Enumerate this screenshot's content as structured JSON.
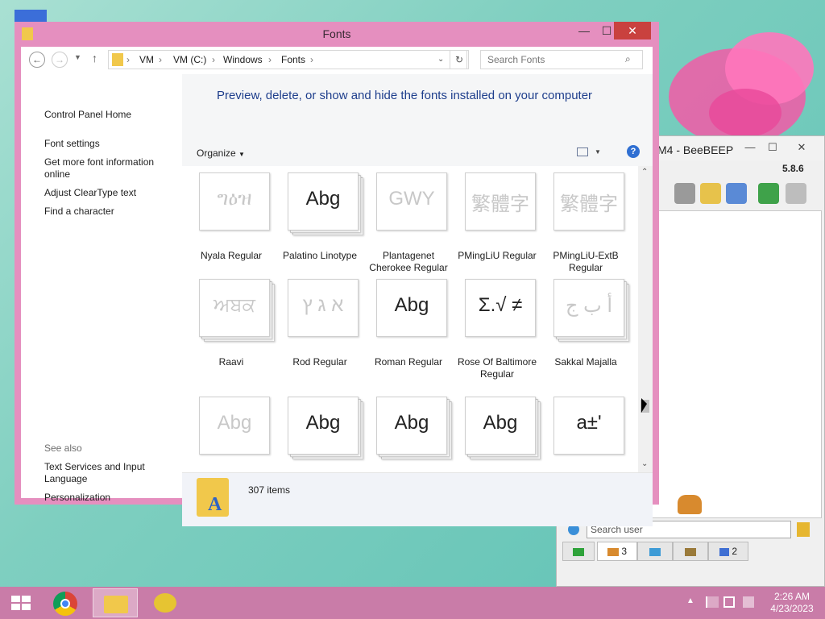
{
  "fonts_window": {
    "title": "Fonts",
    "close_glyph": "✕",
    "minimize_glyph": "—",
    "maximize_glyph": "☐",
    "breadcrumbs": [
      "VM",
      "VM (C:)",
      "Windows",
      "Fonts"
    ],
    "search_placeholder": "Search Fonts",
    "left_links": [
      "Control Panel Home",
      "Font settings",
      "Get more font information online",
      "Adjust ClearType text",
      "Find a character"
    ],
    "see_also_label": "See also",
    "see_also_links": [
      "Text Services and Input Language",
      "Personalization"
    ],
    "heading": "Preview, delete, or show and hide the fonts installed on your computer",
    "organize_label": "Organize",
    "help_glyph": "?",
    "status_count": "307 items",
    "fonts": [
      {
        "name": "Nyala Regular",
        "sample": "ግዕዝ",
        "stack": false,
        "dim": true
      },
      {
        "name": "Palatino Linotype",
        "sample": "Abg",
        "stack": true,
        "dim": false
      },
      {
        "name": "Plantagenet Cherokee Regular",
        "sample": "GWY",
        "stack": false,
        "dim": true
      },
      {
        "name": "PMingLiU Regular",
        "sample": "繁體字",
        "stack": false,
        "dim": true
      },
      {
        "name": "PMingLiU-ExtB Regular",
        "sample": "繁體字",
        "stack": false,
        "dim": true
      },
      {
        "name": "Raavi",
        "sample": "ਅਬਕ",
        "stack": true,
        "dim": true
      },
      {
        "name": "Rod Regular",
        "sample": "א ג ץ",
        "stack": false,
        "dim": true
      },
      {
        "name": "Roman Regular",
        "sample": "Abg",
        "stack": false,
        "dim": false
      },
      {
        "name": "Rose Of Baltimore Regular",
        "sample": "Σ.√ ≠",
        "stack": false,
        "dim": false
      },
      {
        "name": "Sakkal Majalla",
        "sample": "أ ب ج",
        "stack": true,
        "dim": true
      },
      {
        "name": "",
        "sample": "Abg",
        "stack": false,
        "dim": true
      },
      {
        "name": "",
        "sample": "Abg",
        "stack": true,
        "dim": false
      },
      {
        "name": "",
        "sample": "Abg",
        "stack": true,
        "dim": false
      },
      {
        "name": "",
        "sample": "Abg",
        "stack": true,
        "dim": false
      },
      {
        "name": "",
        "sample": "a±ʹ",
        "stack": false,
        "dim": false
      }
    ]
  },
  "beebeep": {
    "title": "M4 - BeeBEEP",
    "version": "5.8.6",
    "search_placeholder": "Search user",
    "tabs": [
      {
        "label": "",
        "icon": "computer-icon"
      },
      {
        "label": "3",
        "icon": "users-icon"
      },
      {
        "label": "",
        "icon": "chat-icon"
      },
      {
        "label": "",
        "icon": "group-icon"
      },
      {
        "label": "2",
        "icon": "share-icon"
      }
    ]
  },
  "taskbar": {
    "time": "2:26 AM",
    "date": "4/23/2023"
  },
  "colors": {
    "window_accent": "#e58fbf",
    "taskbar": "#c97ca8",
    "close_button": "#c9413e",
    "heading_blue": "#1e3e8c"
  }
}
